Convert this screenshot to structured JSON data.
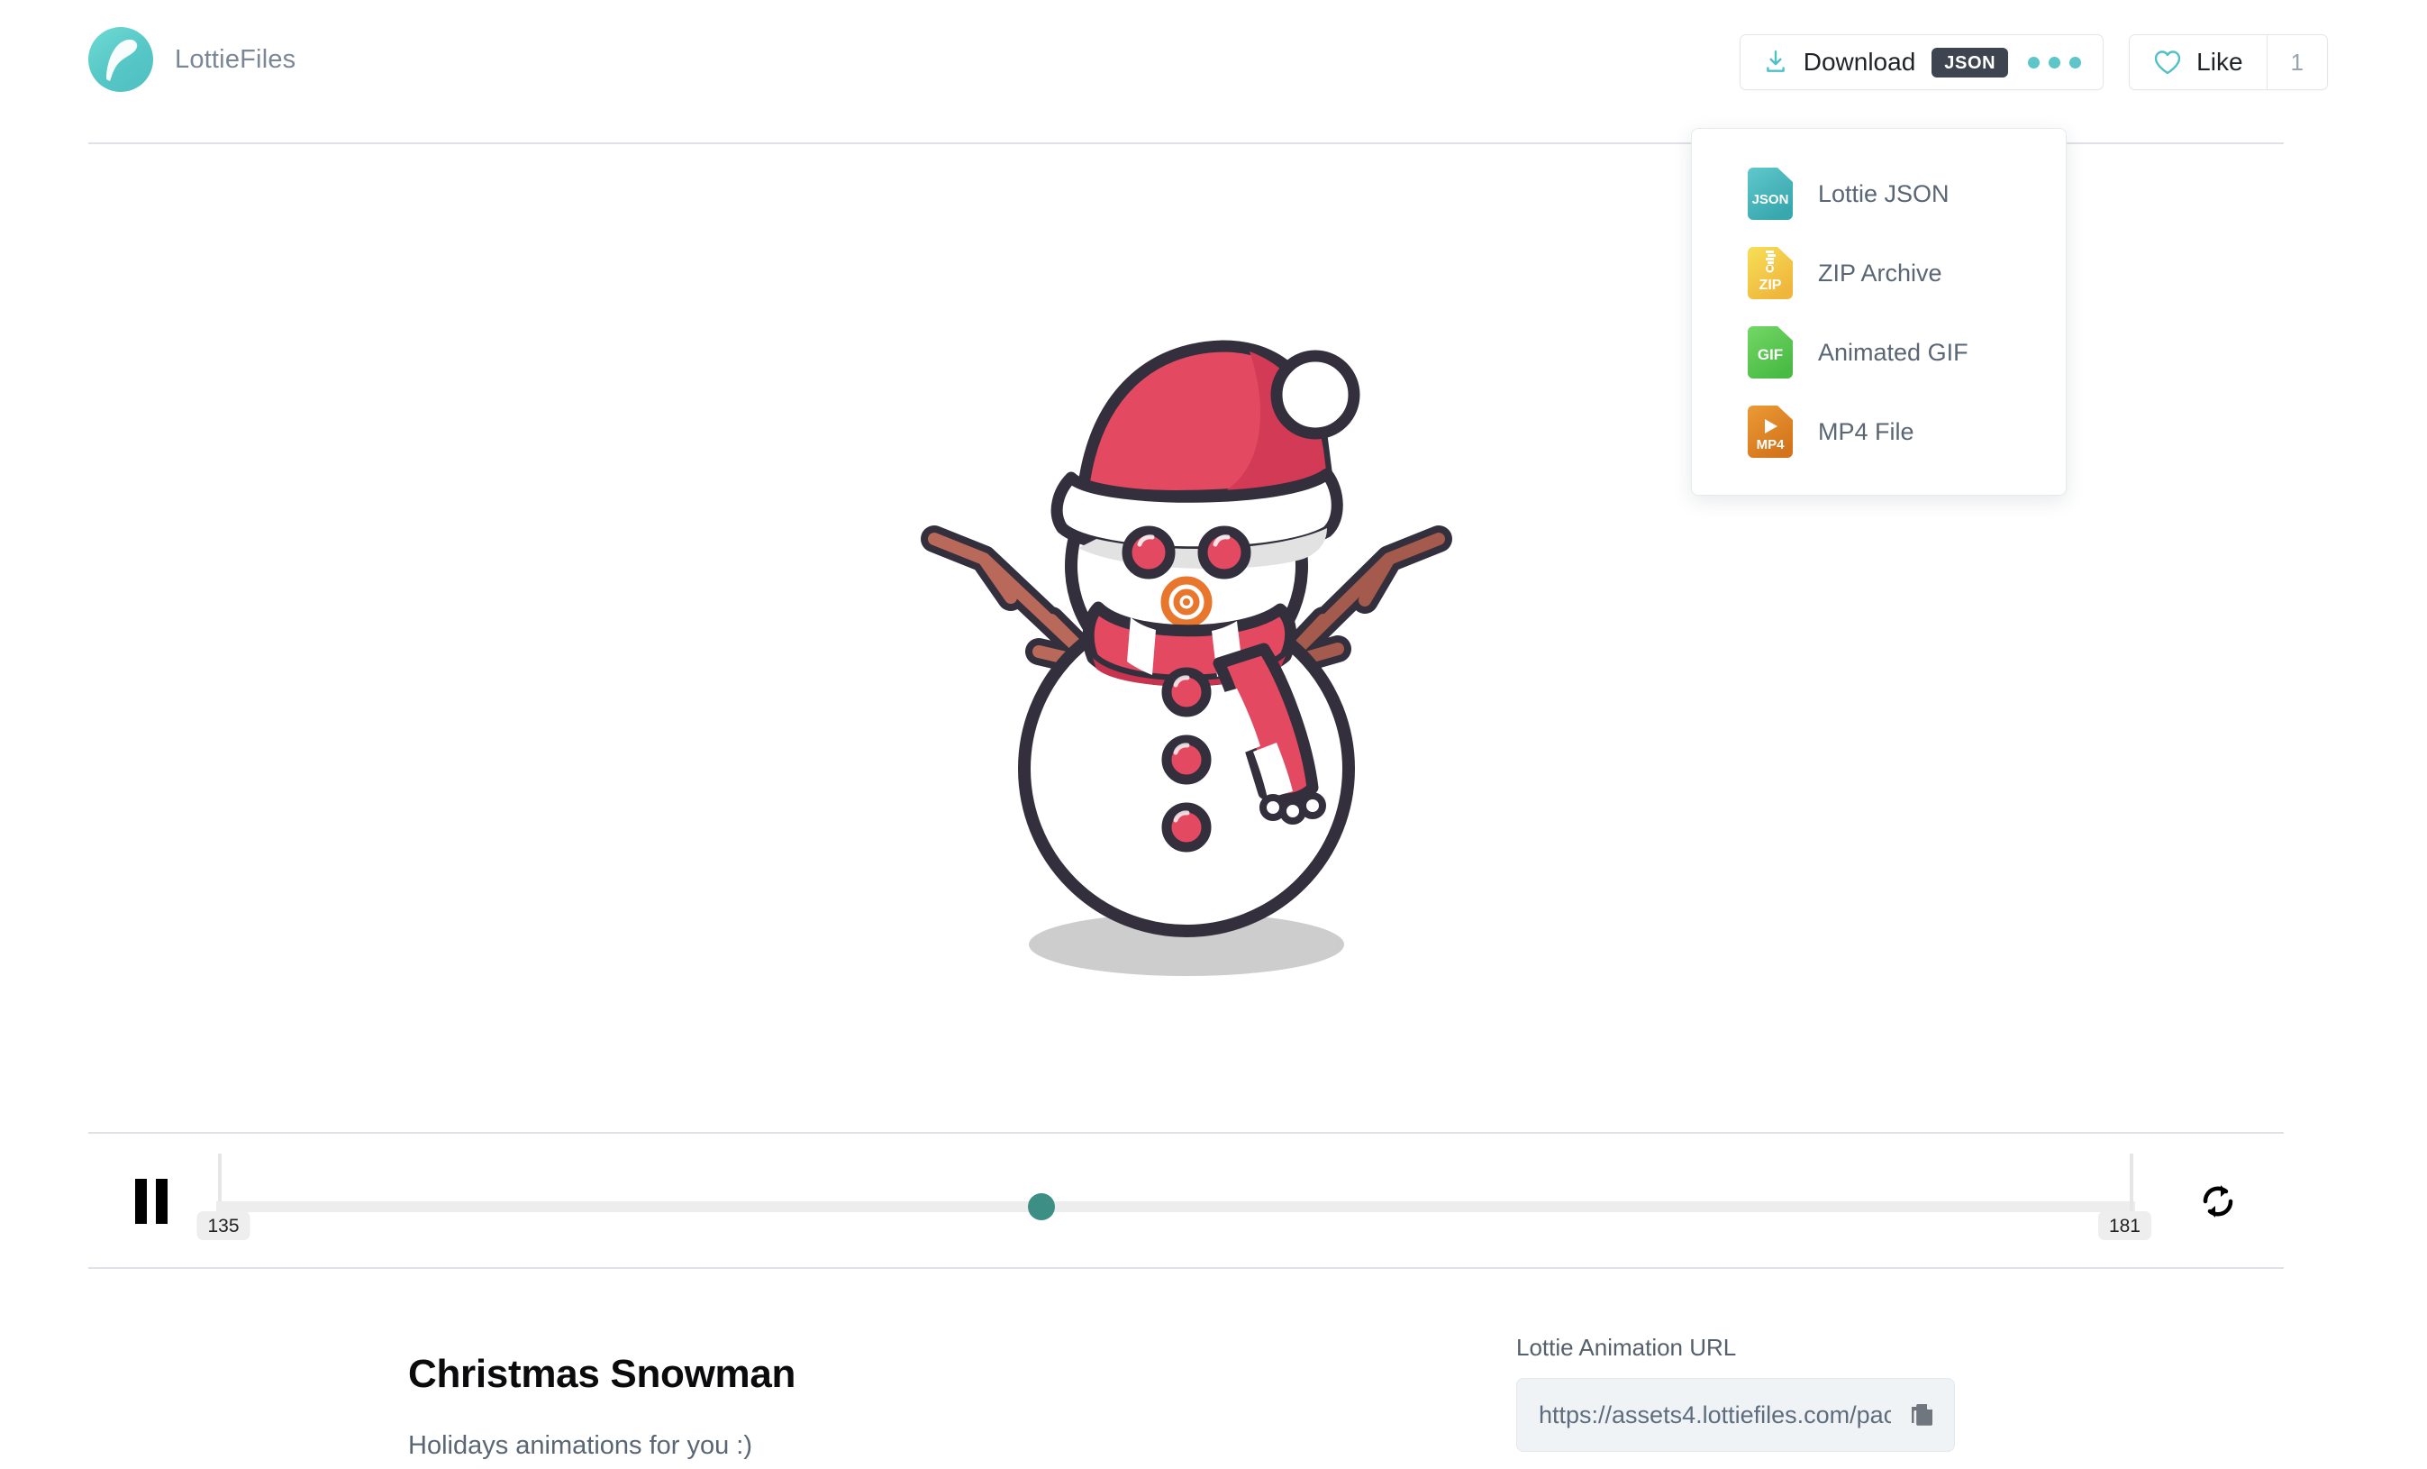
{
  "brand": {
    "name": "LottieFiles",
    "logo_icon": "lottiefiles-logo-icon",
    "accent_color": "#56c7c6"
  },
  "header": {
    "download": {
      "label": "Download",
      "icon": "download-icon",
      "format_badge": "JSON",
      "more_icon": "three-dots-icon"
    },
    "like": {
      "label": "Like",
      "icon": "heart-outline-icon",
      "count": "1"
    }
  },
  "download_menu": {
    "items": [
      {
        "label": "Lottie JSON",
        "icon": "json-file-icon",
        "badge": "JSON",
        "color": "#49b9bd"
      },
      {
        "label": "ZIP Archive",
        "icon": "zip-file-icon",
        "badge": "ZIP",
        "color": "#f2c63f"
      },
      {
        "label": "Animated GIF",
        "icon": "gif-file-icon",
        "badge": "GIF",
        "color": "#5fc955"
      },
      {
        "label": "MP4 File",
        "icon": "mp4-file-icon",
        "badge": "MP4",
        "color": "#e08a2a"
      }
    ]
  },
  "player": {
    "pause_icon": "pause-icon",
    "loop_icon": "loop-repeat-icon",
    "start_frame": "135",
    "end_frame": "181",
    "playhead_color": "#3d8f86",
    "playhead_position_percent": "43"
  },
  "animation": {
    "name": "christmas-snowman-illustration",
    "colors": {
      "outline": "#332f3c",
      "snow_white": "#ffffff",
      "snow_shade": "#e2e2e2",
      "hat_red": "#e34961",
      "hat_red_dark": "#d23a55",
      "branch_brown": "#b9695a",
      "branch_brown_dark": "#a45a4c",
      "nose_orange": "#e8762c",
      "shadow_gray": "#cdcdcd"
    }
  },
  "meta": {
    "title": "Christmas Snowman",
    "description": "Holidays animations for you :)",
    "url_label": "Lottie Animation URL",
    "url_value": "https://assets4.lottiefiles.com/pac",
    "copy_icon": "copy-icon"
  }
}
